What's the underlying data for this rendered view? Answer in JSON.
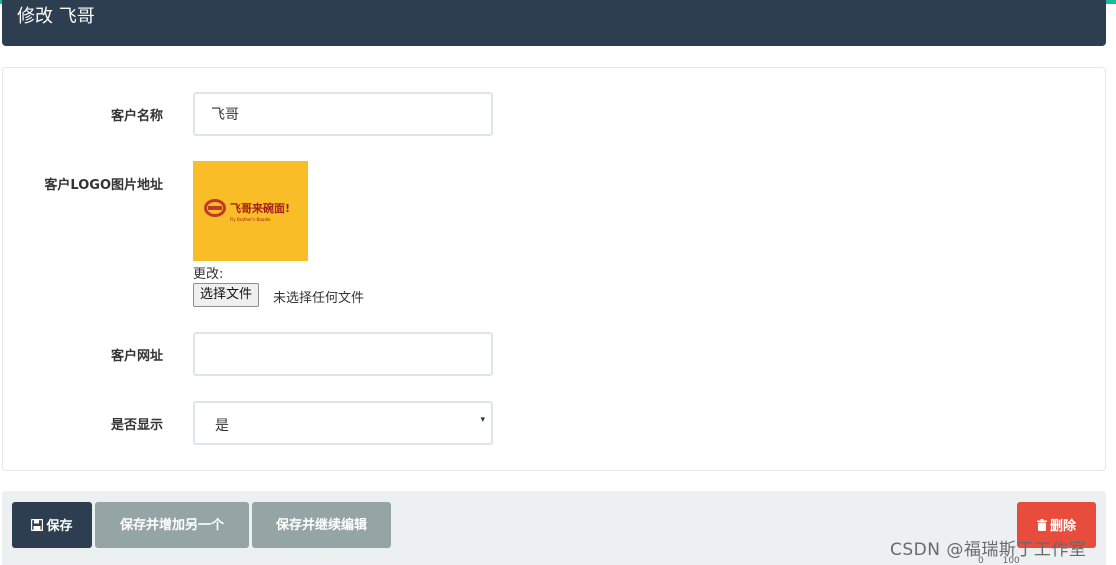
{
  "header": {
    "title": "修改 飞哥"
  },
  "form": {
    "customer_name": {
      "label": "客户名称",
      "value": "飞哥"
    },
    "logo": {
      "label": "客户LOGO图片地址",
      "image_text": "飞哥来碗面!",
      "image_subtext": "Fly Brother's Noodle",
      "change_label": "更改:",
      "file_button": "选择文件",
      "file_status": "未选择任何文件"
    },
    "website": {
      "label": "客户网址",
      "value": ""
    },
    "display": {
      "label": "是否显示",
      "selected": "是",
      "arrow": "▾"
    }
  },
  "actions": {
    "save": "保存",
    "save_add": "保存并增加另一个",
    "save_continue": "保存并继续编辑",
    "delete": "删除"
  },
  "watermark": "CSDN @福瑞斯丁工作室",
  "status_strip": {
    "items": [
      "",
      "",
      "",
      "0",
      "100"
    ]
  },
  "colors": {
    "accent": "#1abc9c",
    "header": "#2c3e50",
    "secondary": "#95a5a6",
    "danger": "#e74c3c",
    "logo_bg": "#f8bd27"
  }
}
